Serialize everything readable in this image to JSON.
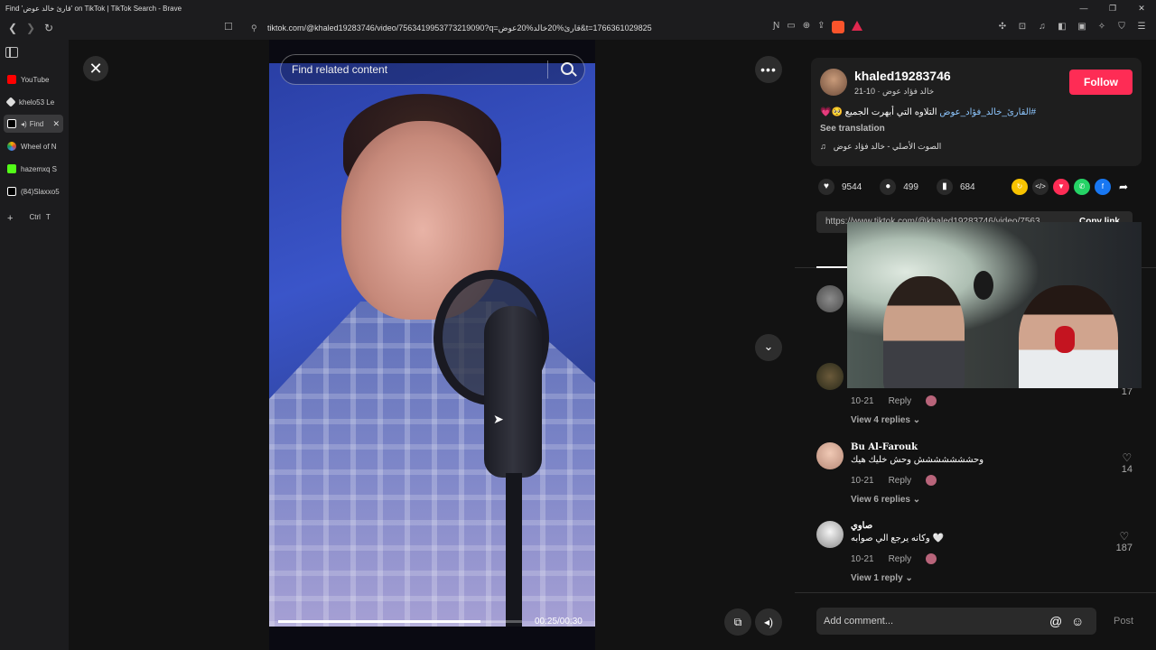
{
  "window": {
    "title": "Find 'قارئ خالد عوض' on TikTok | TikTok Search - Brave"
  },
  "browser": {
    "url": "tiktok.com/@khaled19283746/video/7563419953773219090?q=قارئ%20خالد%20عوض&t=1766361029825",
    "tabs": [
      {
        "label": "YouTube",
        "color": "#ff0000"
      },
      {
        "label": "khelo53 Le",
        "color": "#dddddd"
      },
      {
        "label": "Find",
        "color": "#ffffff",
        "active": true
      },
      {
        "label": "Wheel of N",
        "color": "#f4b400"
      },
      {
        "label": "hazemxq S",
        "color": "#53fc18"
      },
      {
        "label": "(84)Slaxxo5",
        "color": "#ffffff"
      }
    ],
    "new_tab_label": "Ctrl",
    "new_tab_shortcut": "T"
  },
  "video": {
    "search_placeholder": "Find related content",
    "time": "00:25/00:30",
    "progress": 0.83
  },
  "author": {
    "username": "khaled19283746",
    "subline": "خالد فؤاد عوض · 10-21",
    "follow_label": "Follow",
    "caption_tag": "#القارئ_خالد_فؤاد_عوض",
    "caption_text": "التلاوه التي أبهرت الجميع 🥺💗",
    "see_translation": "See translation",
    "sound": "الصوت الأصلي - خالد فؤاد عوض"
  },
  "stats": {
    "likes": "9544",
    "comments": "499",
    "saves": "684"
  },
  "link": {
    "url": "https://www.tiktok.com/@khaled19283746/video/7563...",
    "copy_label": "Copy link"
  },
  "comments": [
    {
      "name": "",
      "text": "",
      "date": "10-21",
      "reply": "Reply",
      "replies": "View 4 replies",
      "likes": "17"
    },
    {
      "name": "Bu Al-Farouk",
      "text": "وحششششششش وحش خليك هيك",
      "date": "10-21",
      "reply": "Reply",
      "replies": "View 6 replies",
      "likes": "14"
    },
    {
      "name": "صاوي",
      "text": "وكانه يرجع الي صوابه 🤍",
      "date": "10-21",
      "reply": "Reply",
      "replies": "View 1 reply",
      "likes": "187"
    }
  ],
  "comment_box": {
    "placeholder": "Add comment...",
    "post_label": "Post"
  }
}
